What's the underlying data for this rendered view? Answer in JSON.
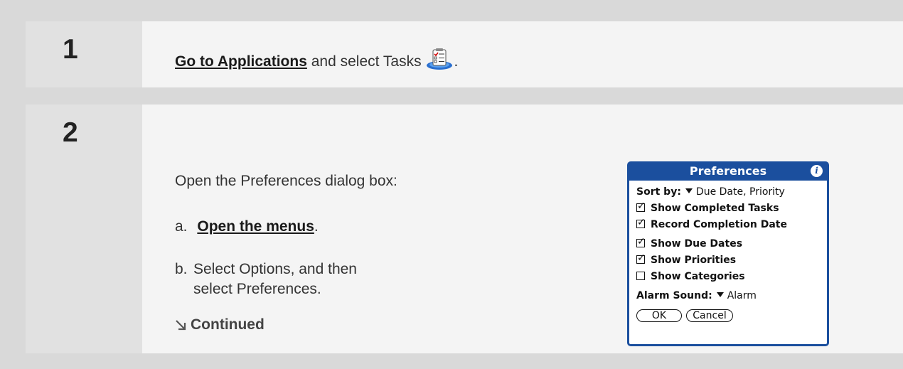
{
  "step1": {
    "number": "1",
    "link": "Go to Applications",
    "text": " and select Tasks ",
    "period": ".",
    "icon": "tasks-app-icon"
  },
  "step2": {
    "number": "2",
    "intro": "Open the Preferences dialog box:",
    "a_prefix": "a.",
    "a_link": "Open the menus",
    "a_suffix": ".",
    "b_prefix": "b.",
    "b_line1": "Select Options, and then",
    "b_line2": "select Preferences.",
    "continued": "Continued"
  },
  "dialog": {
    "title": "Preferences",
    "sort_label": "Sort by:",
    "sort_value": "Due Date, Priority",
    "checkboxes": [
      {
        "label": "Show Completed Tasks",
        "checked": true
      },
      {
        "label": "Record Completion Date",
        "checked": true
      },
      {
        "label": "Show Due Dates",
        "checked": true
      },
      {
        "label": "Show Priorities",
        "checked": true
      },
      {
        "label": "Show Categories",
        "checked": false
      }
    ],
    "alarm_label": "Alarm Sound:",
    "alarm_value": "Alarm",
    "ok": "OK",
    "cancel": "Cancel"
  },
  "colors": {
    "accent": "#1b4f9e",
    "panel": "#f4f4f4",
    "number_bg": "#e1e1e1",
    "page_bg": "#d9d9d9"
  }
}
